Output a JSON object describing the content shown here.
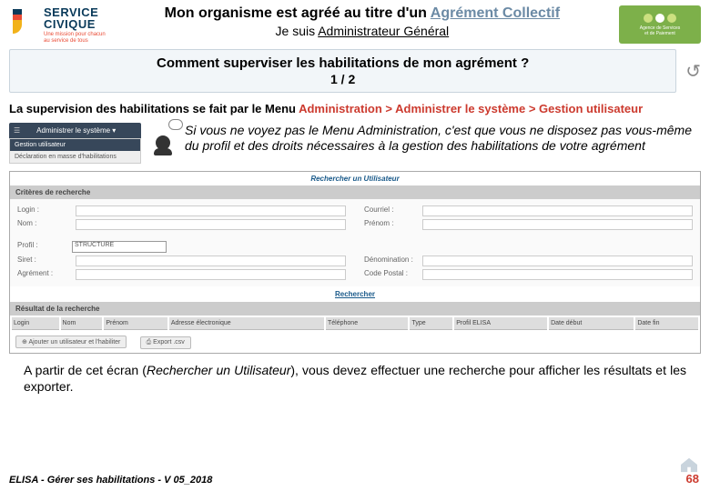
{
  "header": {
    "logo": {
      "line1": "SERVICE",
      "line2": "CIVIQUE",
      "tag1": "Une mission pour chacun",
      "tag2": "au service de tous"
    },
    "title_pre": "Mon organisme est agréé au titre d'un ",
    "title_hl": "Agrément Collectif",
    "subtitle_pre": "Je suis ",
    "subtitle_ul": "Administrateur Général",
    "asp": {
      "line1": "Agence de Services",
      "line2": "et de Paiement"
    }
  },
  "question": {
    "q": "Comment superviser les habilitations de mon agrément ?",
    "page": "1 / 2"
  },
  "supervision": {
    "pre": "La supervision des habilitations se fait par le Menu  ",
    "red": "Administration > Administrer le système > Gestion utilisateur"
  },
  "menu_thumb": {
    "top_left": "☰",
    "top_label": "Administrer le système ▾",
    "row_sel": "Gestion utilisateur",
    "row2": "Déclaration en masse d'habilitations"
  },
  "tip": "Si vous ne voyez pas le Menu Administration, c'est que vous ne disposez pas vous-même du profil et des droits nécessaires à la gestion des habilitations de votre agrément",
  "screenshot": {
    "title": "Rechercher un Utilisateur",
    "criteria_bar": "Critères de recherche",
    "labels": {
      "login": "Login :",
      "courriel": "Courriel :",
      "nom": "Nom :",
      "prenom": "Prénom :",
      "profil": "Profil :",
      "siret": "Siret :",
      "agrement": "Agrément :",
      "denom": "Dénomination :",
      "cp": "Code Postal :"
    },
    "profil_value": "STRUCTURE",
    "search_action": "Rechercher",
    "result_bar": "Résultat de la recherche",
    "cols": [
      "Login",
      "Nom",
      "Prénom",
      "Adresse électronique",
      "Téléphone",
      "Type",
      "Profil ELISA",
      "Date début",
      "Date fin"
    ],
    "btn1": "Ajouter un utilisateur et l'habiliter",
    "btn2": "Export .csv"
  },
  "instr_pre": "A partir de cet écran (",
  "instr_em": "Rechercher un Utilisateur",
  "instr_post": "), vous devez effectuer une recherche pour afficher les résultats et les exporter.",
  "footer": {
    "left": "ELISA - Gérer ses habilitations - V 05_2018",
    "page": "68"
  }
}
